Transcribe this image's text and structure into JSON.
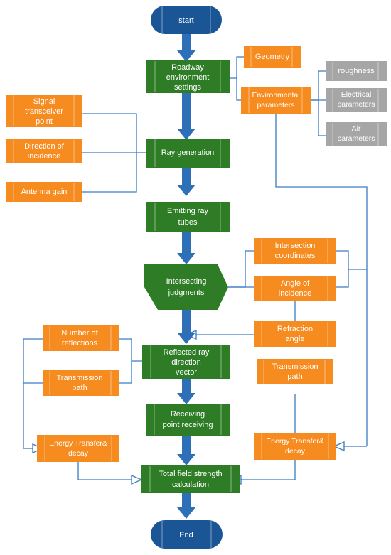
{
  "diagram": {
    "title": "Ray tracing road propagation simulation flowchart",
    "colors": {
      "green": "#2e7d26",
      "blue": "#1a5596",
      "orange": "#f68b1f",
      "gray": "#a6a6a6",
      "connector": "#3a7cc4",
      "flow_arrow": "#2e70b8",
      "text": "#ffffff",
      "background": "#ffffff"
    },
    "nodes": {
      "start": {
        "label": "start",
        "shape": "terminator",
        "color": "blue"
      },
      "roadway_environment_settings": {
        "label_lines": [
          "Roadway",
          "environment",
          "settings"
        ],
        "shape": "process",
        "color": "green"
      },
      "geometry": {
        "label": "Geometry",
        "shape": "box",
        "color": "orange"
      },
      "environmental_parameters": {
        "label_lines": [
          "Environmental",
          "parameters"
        ],
        "shape": "box",
        "color": "orange"
      },
      "roughness": {
        "label": "roughness",
        "shape": "box",
        "color": "gray"
      },
      "electrical_parameters": {
        "label_lines": [
          "Electrical",
          "parameters"
        ],
        "shape": "box",
        "color": "gray"
      },
      "air_parameters": {
        "label_lines": [
          "Air",
          "parameters"
        ],
        "shape": "box",
        "color": "gray"
      },
      "signal_transceiver_point": {
        "label_lines": [
          "Signal",
          "transceiver",
          "point"
        ],
        "shape": "box",
        "color": "orange"
      },
      "direction_of_incidence": {
        "label_lines": [
          "Direction of",
          "incidence"
        ],
        "shape": "box",
        "color": "orange"
      },
      "antenna_gain": {
        "label": "Antenna gain",
        "shape": "box",
        "color": "orange"
      },
      "ray_generation": {
        "label": "Ray generation",
        "shape": "process",
        "color": "green"
      },
      "emitting_ray_tubes": {
        "label_lines": [
          "Emitting ray",
          "tubes"
        ],
        "shape": "process",
        "color": "green"
      },
      "intersecting_judgments": {
        "label_lines": [
          "Intersecting",
          "judgments"
        ],
        "shape": "hexagon",
        "color": "green"
      },
      "intersection_coordinates": {
        "label_lines": [
          "Intersection",
          "coordinates"
        ],
        "shape": "box",
        "color": "orange"
      },
      "angle_of_incidence": {
        "label_lines": [
          "Angle of",
          "incidence"
        ],
        "shape": "box",
        "color": "orange"
      },
      "refraction_angle": {
        "label_lines": [
          "Refraction",
          "angle"
        ],
        "shape": "box",
        "color": "orange"
      },
      "reflected_ray_direction_vector": {
        "label_lines": [
          "Reflected ray",
          "direction",
          "vector"
        ],
        "shape": "process",
        "color": "green"
      },
      "number_of_reflections": {
        "label_lines": [
          "Number of",
          "reflections"
        ],
        "shape": "box",
        "color": "orange"
      },
      "transmission_path_left": {
        "label_lines": [
          "Transmission",
          "path"
        ],
        "shape": "box",
        "color": "orange"
      },
      "transmission_path_right": {
        "label_lines": [
          "Transmission",
          "path"
        ],
        "shape": "box",
        "color": "orange"
      },
      "receiving_point_receiving": {
        "label_lines": [
          "Receiving",
          "point receiving"
        ],
        "shape": "process",
        "color": "green"
      },
      "energy_transfer_decay_left": {
        "label_lines": [
          "Energy Transfer&",
          "decay"
        ],
        "shape": "box",
        "color": "orange"
      },
      "energy_transfer_decay_right": {
        "label_lines": [
          "Energy Transfer&",
          "decay"
        ],
        "shape": "box",
        "color": "orange"
      },
      "total_field_strength_calculation": {
        "label_lines": [
          "Total field strength",
          "calculation"
        ],
        "shape": "process",
        "color": "green"
      },
      "end": {
        "label": "End",
        "shape": "terminator",
        "color": "blue"
      }
    }
  }
}
